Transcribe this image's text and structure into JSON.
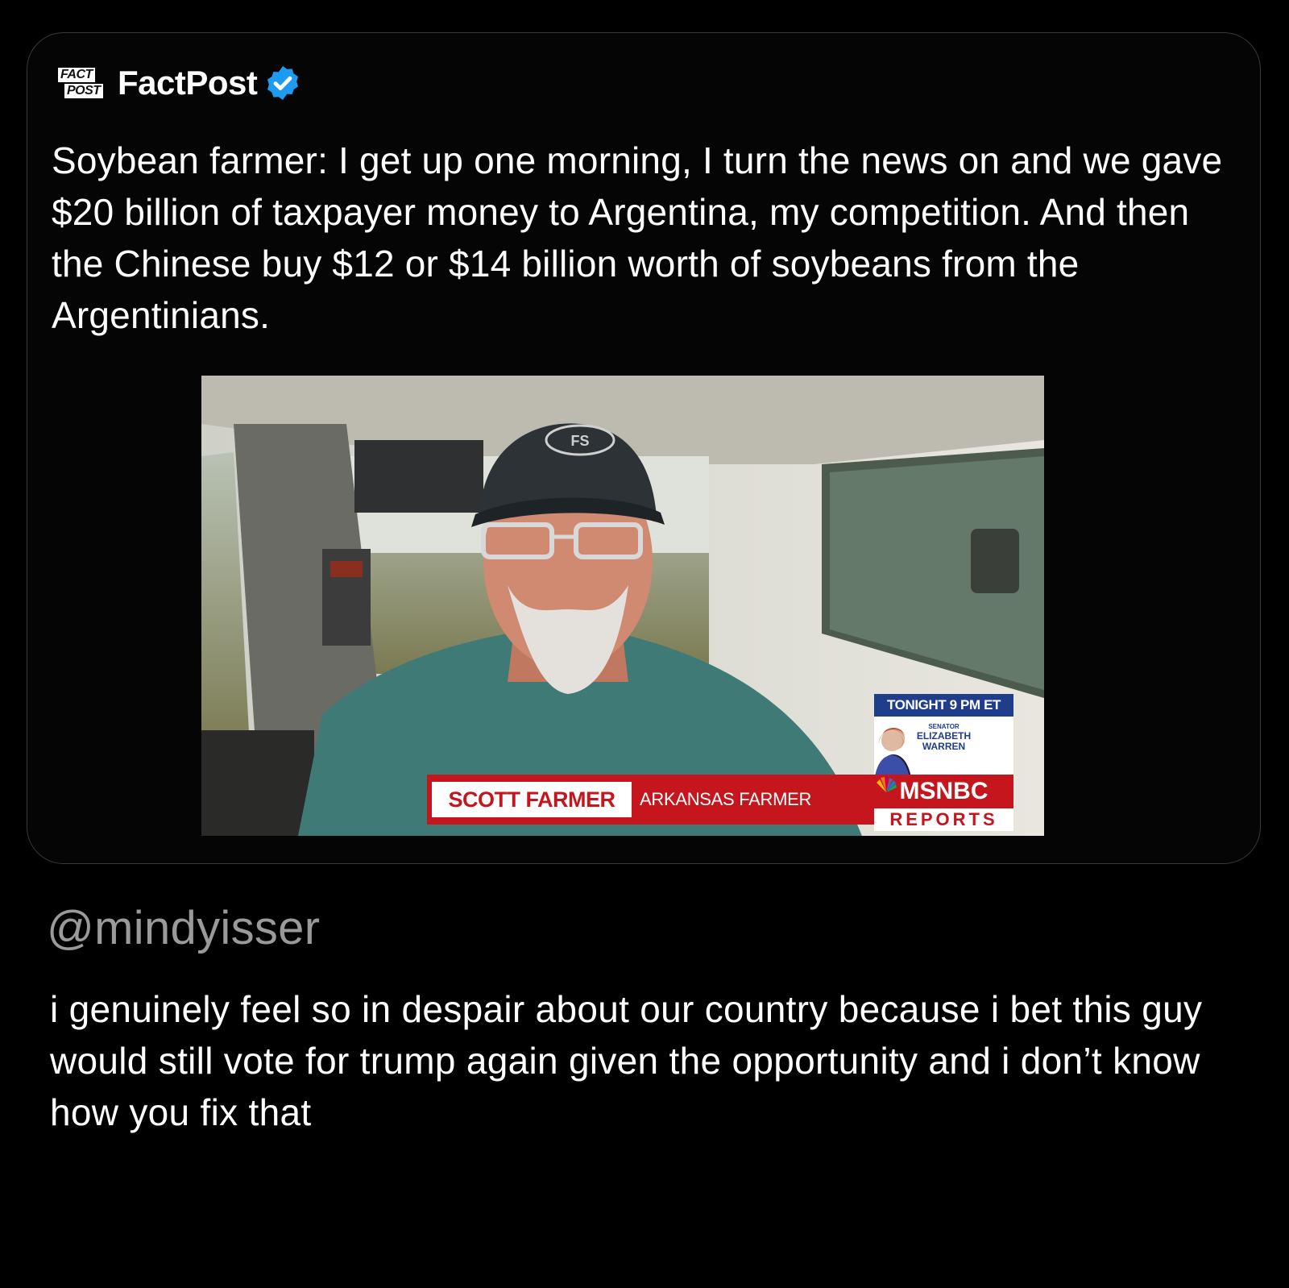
{
  "post": {
    "account_name": "FactPost",
    "logo_line1": "FACT",
    "logo_line2": "POST",
    "verified_icon": "verified-badge-icon",
    "text": "Soybean farmer: I get up one morning, I turn the news on and we gave $20 billion of taxpayer money to Argentina, my competition. And then the Chinese buy $12 or $14 billion worth of soybeans from the Argentinians."
  },
  "video": {
    "lower_third_name": "SCOTT FARMER",
    "lower_third_title": "ARKANSAS FARMER",
    "promo_time": "TONIGHT 9 PM ET",
    "promo_role": "SENATOR",
    "promo_guest": "ELIZABETH WARREN",
    "network": "MSNBC",
    "program": "REPORTS",
    "cap_logo": "FS"
  },
  "reply": {
    "handle": "@mindyisser",
    "text": "i genuinely feel so in despair about our country because i bet this guy would still vote for trump again given the opportunity and i don’t know how you fix that"
  },
  "colors": {
    "background": "#000000",
    "card_border": "#3a3a3a",
    "verified": "#1d9bf0",
    "msnbc_red": "#c4161c",
    "promo_blue": "#1f3d8a",
    "handle_gray": "#9a9a9a"
  }
}
